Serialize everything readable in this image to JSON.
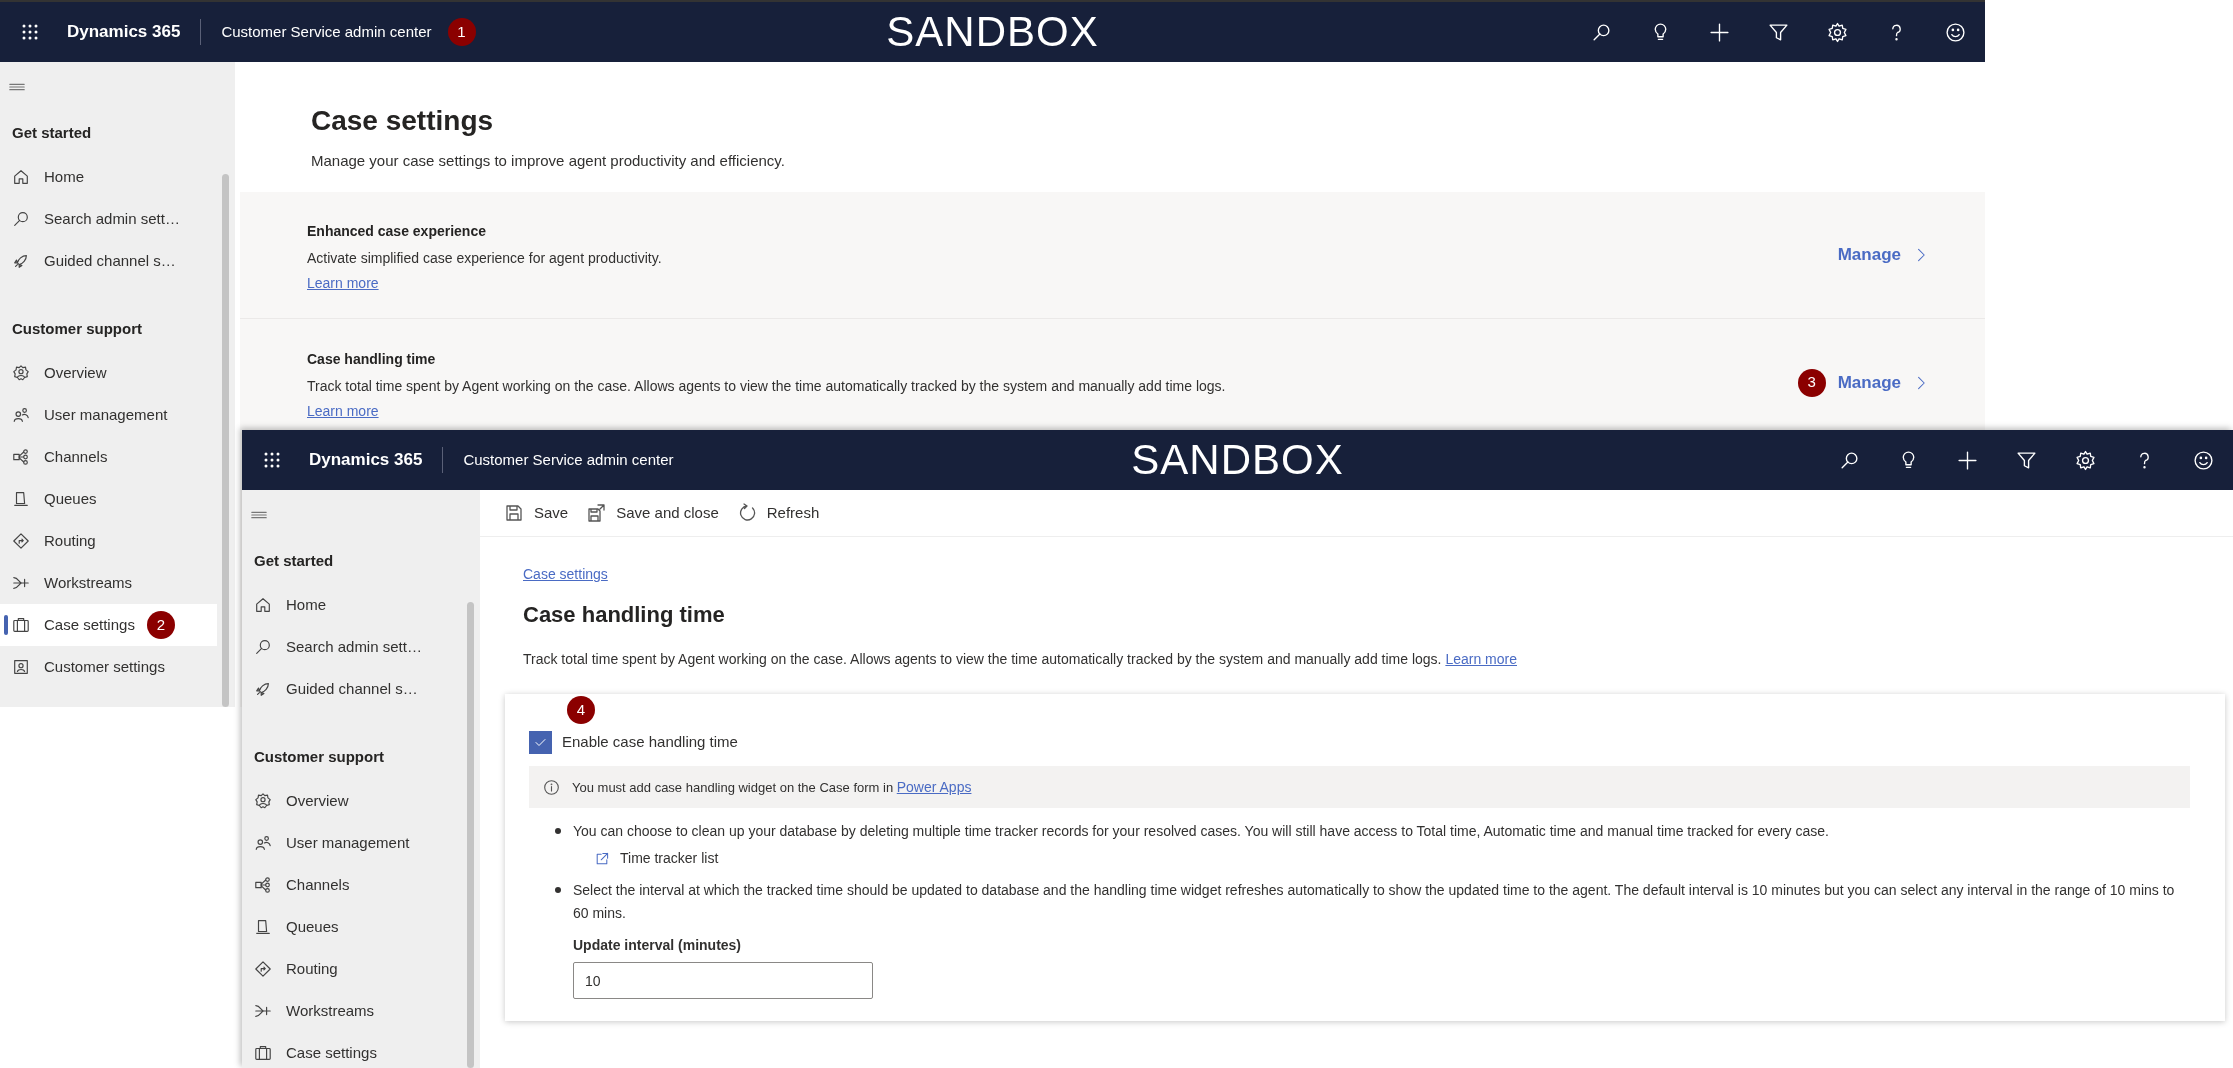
{
  "back_window": {
    "header": {
      "app_name": "Dynamics 365",
      "app_title": "Customer Service admin center",
      "badge": "1",
      "environment": "SANDBOX"
    },
    "sidebar": [
      {
        "heading": "Get started",
        "items": [
          {
            "label": "Home",
            "selected": false
          },
          {
            "label": "Search admin sett…",
            "selected": false
          },
          {
            "label": "Guided channel s…",
            "selected": false
          }
        ]
      },
      {
        "heading": "Customer support",
        "items": [
          {
            "label": "Overview",
            "selected": false
          },
          {
            "label": "User management",
            "selected": false
          },
          {
            "label": "Channels",
            "selected": false
          },
          {
            "label": "Queues",
            "selected": false
          },
          {
            "label": "Routing",
            "selected": false
          },
          {
            "label": "Workstreams",
            "selected": false
          },
          {
            "label": "Case settings",
            "selected": true,
            "badge": "2"
          },
          {
            "label": "Customer settings",
            "selected": false
          }
        ]
      }
    ],
    "page": {
      "title": "Case settings",
      "subtitle": "Manage your case settings to improve agent productivity and efficiency.",
      "cards": [
        {
          "title": "Enhanced case experience",
          "description": "Activate simplified case experience for agent productivity.",
          "link": "Learn more",
          "action": "Manage"
        },
        {
          "title": "Case handling time",
          "description": "Track total time spent by Agent working on the case. Allows agents to view the time automatically tracked by the system and manually add time logs.",
          "link": "Learn more",
          "action": "Manage",
          "badge": "3"
        }
      ]
    }
  },
  "front_window": {
    "header": {
      "app_name": "Dynamics 365",
      "app_title": "Customer Service admin center",
      "environment": "SANDBOX"
    },
    "sidebar": [
      {
        "heading": "Get started",
        "items": [
          {
            "label": "Home",
            "selected": false
          },
          {
            "label": "Search admin sett…",
            "selected": false
          },
          {
            "label": "Guided channel s…",
            "selected": false
          }
        ]
      },
      {
        "heading": "Customer support",
        "items": [
          {
            "label": "Overview",
            "selected": false
          },
          {
            "label": "User management",
            "selected": false
          },
          {
            "label": "Channels",
            "selected": false
          },
          {
            "label": "Queues",
            "selected": false
          },
          {
            "label": "Routing",
            "selected": false
          },
          {
            "label": "Workstreams",
            "selected": false
          },
          {
            "label": "Case settings",
            "selected": false
          }
        ]
      }
    ],
    "toolbar": [
      {
        "label": "Save"
      },
      {
        "label": "Save and close"
      },
      {
        "label": "Refresh"
      }
    ],
    "breadcrumb": "Case settings",
    "title": "Case handling time",
    "description": "Track total time spent by Agent working on the case. Allows agents to view the time automatically tracked by the system and manually add time logs.",
    "learn_more": "Learn more",
    "settings": {
      "badge": "4",
      "checkbox": {
        "label": "Enable case handling time",
        "checked": true
      },
      "info": {
        "text": "You must add case handling widget on the Case form in",
        "link": "Power Apps"
      },
      "bullets": [
        {
          "text": "You can choose to clean up your database by deleting multiple time tracker records for your resolved cases. You will still have access to Total time, Automatic time and manual time tracked for every case.",
          "link": "Time tracker list"
        },
        {
          "text": "Select the interval at which the tracked time should be updated to database and the handling time widget refreshes automatically to show the updated time to the agent. The default interval is 10 minutes but you can select any interval in the range of 10 mins to 60 mins.",
          "field": {
            "label": "Update interval (minutes)",
            "value": "10"
          }
        }
      ]
    }
  }
}
